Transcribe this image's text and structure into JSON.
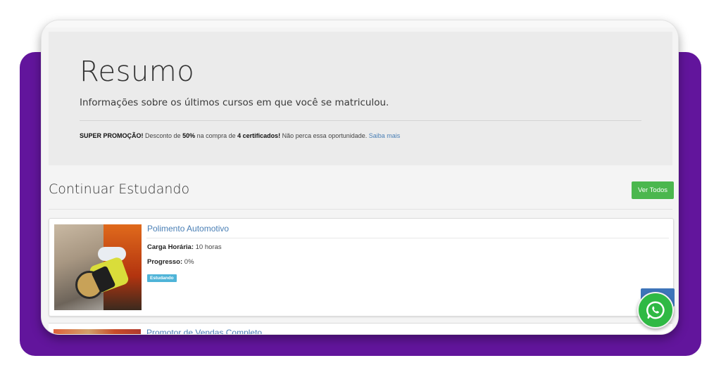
{
  "jumbotron": {
    "title": "Resumo",
    "subtitle": "Informações sobre os últimos cursos em que você se matriculou.",
    "promo": {
      "label": "SUPER PROMOÇÃO!",
      "text1": " Desconto de ",
      "discount": "50%",
      "text2": " na compra de ",
      "quantity": "4 certificados!",
      "text3": " Não perca essa oportunidade. ",
      "link": "Saiba mais"
    }
  },
  "section": {
    "title": "Continuar Estudando",
    "view_all_label": "Ver Todos"
  },
  "courses": [
    {
      "title": "Polimento Automotivo",
      "workload_label": "Carga Horária:",
      "workload_value": " 10 horas",
      "progress_label": "Progresso:",
      "progress_value": " 0%",
      "status": "Estudando"
    },
    {
      "title": "Promotor de Vendas Completo"
    }
  ],
  "colors": {
    "purple": "#62159c",
    "green_button": "#4bb74e",
    "link_blue": "#4a7fb5",
    "badge": "#4fb4d8",
    "whatsapp": "#2fb944"
  }
}
